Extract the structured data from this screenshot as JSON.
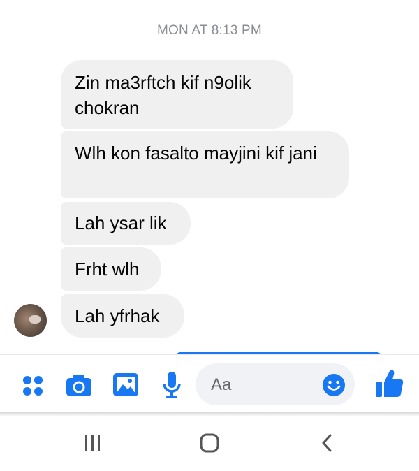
{
  "conversation": {
    "timestamp": "MON AT 8:13 PM",
    "messages": [
      {
        "text": "Zin ma3rftch kif n9olik chokran",
        "direction": "received"
      },
      {
        "text": "Wlh kon fasalto mayjini kif jani",
        "direction": "received"
      },
      {
        "text": "Lah ysar lik",
        "direction": "received"
      },
      {
        "text": "Frht wlh",
        "direction": "received"
      },
      {
        "text": "Lah yfrhak",
        "direction": "received"
      }
    ]
  },
  "composer": {
    "placeholder": "Aa",
    "accent_color": "#1877f2",
    "icons": [
      "more-apps-icon",
      "camera-icon",
      "gallery-icon",
      "microphone-icon",
      "emoji-icon",
      "thumbs-up-icon"
    ]
  },
  "system_nav": {
    "icons": [
      "recent-apps-icon",
      "home-icon",
      "back-icon"
    ]
  }
}
